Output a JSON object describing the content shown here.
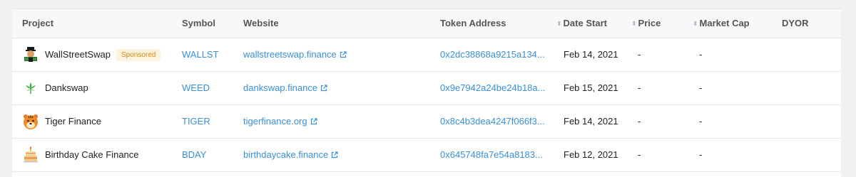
{
  "headers": {
    "project": "Project",
    "symbol": "Symbol",
    "website": "Website",
    "token_address": "Token Address",
    "date_start": "Date Start",
    "price": "Price",
    "market_cap": "Market Cap",
    "dyor": "DYOR"
  },
  "colors": {
    "link": "#3a8fd6",
    "sponsored_bg": "#fdf3dd",
    "sponsored_text": "#c98a1a"
  },
  "rows": [
    {
      "logo_icon": "wallstreetswap-bull-logo-icon",
      "name": "WallStreetSwap",
      "badge": "Sponsored",
      "symbol": "WALLST",
      "website": "wallstreetswap.finance",
      "token_address": "0x2dc38868a9215a134...",
      "date_start": "Feb 14, 2021",
      "price": "-",
      "market_cap": "-"
    },
    {
      "logo_icon": "weed-leaf-logo-icon",
      "name": "Dankswap",
      "badge": "",
      "symbol": "WEED",
      "website": "dankswap.finance",
      "token_address": "0x9e7942a24be24b18a...",
      "date_start": "Feb 15, 2021",
      "price": "-",
      "market_cap": "-"
    },
    {
      "logo_icon": "tiger-face-logo-icon",
      "name": "Tiger Finance",
      "badge": "",
      "symbol": "TIGER",
      "website": "tigerfinance.org",
      "token_address": "0x8c4b3dea4247f066f3...",
      "date_start": "Feb 14, 2021",
      "price": "-",
      "market_cap": "-"
    },
    {
      "logo_icon": "birthday-cake-logo-icon",
      "name": "Birthday Cake Finance",
      "badge": "",
      "symbol": "BDAY",
      "website": "birthdaycake.finance",
      "token_address": "0x645748fa7e54a8183...",
      "date_start": "Feb 12, 2021",
      "price": "-",
      "market_cap": "-"
    }
  ]
}
